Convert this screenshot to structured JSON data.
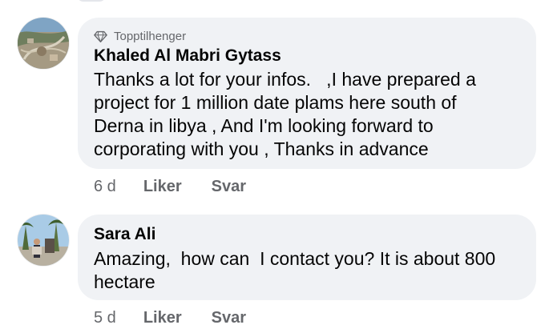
{
  "comments": [
    {
      "badge": "Topptilhenger",
      "author": "Khaled Al Mabri Gytass",
      "text": "Thanks a lot for your infos.   ,I have prepared a\nproject for 1 million date plams here south of\nDerna in libya , And I'm looking forward to\ncorporating with you , Thanks in advance",
      "time": "6 d",
      "like": "Liker",
      "reply": "Svar"
    },
    {
      "author": "Sara Ali",
      "text": "Amazing,  how can  I contact you? It is about 800\nhectare",
      "time": "5 d",
      "like": "Liker",
      "reply": "Svar"
    }
  ],
  "icons": {
    "badge": "diamond-icon"
  },
  "colors": {
    "bubble": "#f0f2f5",
    "meta": "#65676b",
    "text": "#050505"
  }
}
